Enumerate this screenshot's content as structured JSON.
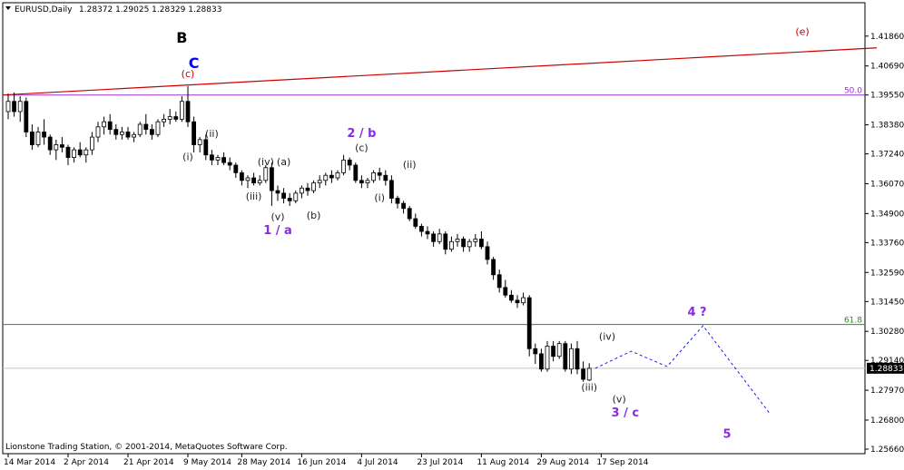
{
  "chart_data": {
    "type": "candlestick",
    "header": {
      "symbol": "EURUSD,Daily",
      "ohlc": "1.28372 1.29025 1.28329 1.28833"
    },
    "footer": "Lionstone Trading Station, © 2001-2014, MetaQuotes Software Corp.",
    "ylim": [
      1.2566,
      1.426
    ],
    "y_ticks": [
      "1.41860",
      "1.40690",
      "1.39550",
      "1.38380",
      "1.37240",
      "1.36070",
      "1.34900",
      "1.33760",
      "1.32590",
      "1.31450",
      "1.30280",
      "1.29140",
      "1.27970",
      "1.26800",
      "1.25660"
    ],
    "x_ticks": [
      "14 Mar 2014",
      "2 Apr 2014",
      "21 Apr 2014",
      "9 May 2014",
      "28 May 2014",
      "16 Jun 2014",
      "4 Jul 2014",
      "23 Jul 2014",
      "11 Aug 2014",
      "29 Aug 2014",
      "17 Sep 2014"
    ],
    "current_price": "1.28833",
    "levels": [
      {
        "label": "50.0",
        "value": 1.3955,
        "color": "#9932cc"
      },
      {
        "label": "61.8",
        "value": 1.3055,
        "color": "#2e8b2e"
      }
    ],
    "trendline": {
      "from": [
        0,
        1.3955
      ],
      "to": [
        145,
        1.414
      ],
      "color": "#cc0000"
    },
    "candles": [
      [
        1.389,
        1.396,
        1.386,
        1.393
      ],
      [
        1.393,
        1.3965,
        1.387,
        1.389
      ],
      [
        1.389,
        1.395,
        1.385,
        1.393
      ],
      [
        1.393,
        1.3945,
        1.379,
        1.381
      ],
      [
        1.381,
        1.384,
        1.374,
        1.376
      ],
      [
        1.376,
        1.383,
        1.375,
        1.381
      ],
      [
        1.381,
        1.386,
        1.376,
        1.379
      ],
      [
        1.379,
        1.38,
        1.372,
        1.374
      ],
      [
        1.374,
        1.378,
        1.37,
        1.376
      ],
      [
        1.376,
        1.379,
        1.373,
        1.375
      ],
      [
        1.375,
        1.376,
        1.368,
        1.371
      ],
      [
        1.371,
        1.375,
        1.369,
        1.374
      ],
      [
        1.374,
        1.377,
        1.371,
        1.372
      ],
      [
        1.372,
        1.375,
        1.369,
        1.374
      ],
      [
        1.374,
        1.381,
        1.372,
        1.379
      ],
      [
        1.379,
        1.385,
        1.377,
        1.383
      ],
      [
        1.383,
        1.387,
        1.38,
        1.385
      ],
      [
        1.385,
        1.388,
        1.38,
        1.382
      ],
      [
        1.382,
        1.384,
        1.378,
        1.38
      ],
      [
        1.38,
        1.383,
        1.378,
        1.381
      ],
      [
        1.381,
        1.383,
        1.378,
        1.379
      ],
      [
        1.379,
        1.381,
        1.377,
        1.38
      ],
      [
        1.38,
        1.385,
        1.379,
        1.384
      ],
      [
        1.384,
        1.388,
        1.38,
        1.382
      ],
      [
        1.382,
        1.384,
        1.378,
        1.38
      ],
      [
        1.38,
        1.386,
        1.379,
        1.385
      ],
      [
        1.385,
        1.388,
        1.383,
        1.386
      ],
      [
        1.386,
        1.39,
        1.384,
        1.387
      ],
      [
        1.387,
        1.389,
        1.385,
        1.386
      ],
      [
        1.386,
        1.395,
        1.385,
        1.393
      ],
      [
        1.393,
        1.399,
        1.383,
        1.385
      ],
      [
        1.385,
        1.387,
        1.373,
        1.376
      ],
      [
        1.376,
        1.379,
        1.373,
        1.378
      ],
      [
        1.378,
        1.38,
        1.37,
        1.372
      ],
      [
        1.372,
        1.374,
        1.368,
        1.37
      ],
      [
        1.37,
        1.372,
        1.368,
        1.371
      ],
      [
        1.371,
        1.373,
        1.368,
        1.369
      ],
      [
        1.369,
        1.371,
        1.366,
        1.368
      ],
      [
        1.368,
        1.369,
        1.363,
        1.365
      ],
      [
        1.365,
        1.366,
        1.36,
        1.362
      ],
      [
        1.362,
        1.364,
        1.359,
        1.363
      ],
      [
        1.363,
        1.365,
        1.36,
        1.361
      ],
      [
        1.361,
        1.364,
        1.36,
        1.362
      ],
      [
        1.362,
        1.368,
        1.361,
        1.367
      ],
      [
        1.367,
        1.369,
        1.352,
        1.358
      ],
      [
        1.358,
        1.36,
        1.354,
        1.357
      ],
      [
        1.357,
        1.359,
        1.353,
        1.355
      ],
      [
        1.355,
        1.357,
        1.352,
        1.354
      ],
      [
        1.354,
        1.358,
        1.353,
        1.357
      ],
      [
        1.357,
        1.36,
        1.355,
        1.359
      ],
      [
        1.359,
        1.361,
        1.356,
        1.358
      ],
      [
        1.358,
        1.362,
        1.357,
        1.361
      ],
      [
        1.361,
        1.364,
        1.359,
        1.362
      ],
      [
        1.362,
        1.365,
        1.36,
        1.364
      ],
      [
        1.364,
        1.366,
        1.361,
        1.363
      ],
      [
        1.363,
        1.366,
        1.362,
        1.365
      ],
      [
        1.365,
        1.372,
        1.364,
        1.37
      ],
      [
        1.37,
        1.371,
        1.366,
        1.368
      ],
      [
        1.368,
        1.369,
        1.361,
        1.362
      ],
      [
        1.362,
        1.364,
        1.359,
        1.361
      ],
      [
        1.361,
        1.363,
        1.359,
        1.362
      ],
      [
        1.362,
        1.366,
        1.361,
        1.365
      ],
      [
        1.365,
        1.367,
        1.362,
        1.364
      ],
      [
        1.364,
        1.366,
        1.36,
        1.362
      ],
      [
        1.362,
        1.364,
        1.353,
        1.355
      ],
      [
        1.355,
        1.356,
        1.351,
        1.353
      ],
      [
        1.353,
        1.354,
        1.349,
        1.351
      ],
      [
        1.351,
        1.352,
        1.346,
        1.347
      ],
      [
        1.347,
        1.349,
        1.343,
        1.344
      ],
      [
        1.344,
        1.345,
        1.34,
        1.342
      ],
      [
        1.342,
        1.344,
        1.339,
        1.341
      ],
      [
        1.341,
        1.342,
        1.336,
        1.338
      ],
      [
        1.338,
        1.343,
        1.337,
        1.341
      ],
      [
        1.341,
        1.342,
        1.333,
        1.335
      ],
      [
        1.335,
        1.34,
        1.334,
        1.338
      ],
      [
        1.338,
        1.341,
        1.336,
        1.339
      ],
      [
        1.339,
        1.34,
        1.334,
        1.336
      ],
      [
        1.336,
        1.339,
        1.334,
        1.338
      ],
      [
        1.338,
        1.341,
        1.336,
        1.339
      ],
      [
        1.339,
        1.342,
        1.335,
        1.336
      ],
      [
        1.336,
        1.338,
        1.329,
        1.331
      ],
      [
        1.331,
        1.332,
        1.323,
        1.325
      ],
      [
        1.325,
        1.327,
        1.318,
        1.32
      ],
      [
        1.32,
        1.323,
        1.316,
        1.317
      ],
      [
        1.317,
        1.319,
        1.314,
        1.315
      ],
      [
        1.315,
        1.317,
        1.312,
        1.314
      ],
      [
        1.314,
        1.318,
        1.313,
        1.316
      ],
      [
        1.316,
        1.317,
        1.293,
        1.296
      ],
      [
        1.296,
        1.298,
        1.29,
        1.294
      ],
      [
        1.294,
        1.296,
        1.287,
        1.288
      ],
      [
        1.288,
        1.299,
        1.287,
        1.297
      ],
      [
        1.297,
        1.299,
        1.291,
        1.293
      ],
      [
        1.293,
        1.299,
        1.292,
        1.298
      ],
      [
        1.298,
        1.299,
        1.287,
        1.288
      ],
      [
        1.288,
        1.298,
        1.286,
        1.296
      ],
      [
        1.296,
        1.299,
        1.286,
        1.288
      ],
      [
        1.288,
        1.291,
        1.283,
        1.284
      ],
      [
        1.2837,
        1.2903,
        1.2833,
        1.2883
      ]
    ],
    "projection": [
      [
        98,
        1.2883
      ],
      [
        104,
        1.295
      ],
      [
        110,
        1.289
      ],
      [
        116,
        1.305
      ],
      [
        127,
        1.271
      ]
    ],
    "wave_labels": [
      {
        "text": "B",
        "idx": 29,
        "price": 1.416,
        "color": "#000000",
        "size": "big"
      },
      {
        "text": "C",
        "idx": 31,
        "price": 1.406,
        "color": "#0000ff",
        "size": "big"
      },
      {
        "text": "(c)",
        "idx": 30,
        "price": 1.4025,
        "color": "#cc0000",
        "size": "small"
      },
      {
        "text": "(e)",
        "idx": 140,
        "price": 1.419,
        "color": "#cc0000",
        "size": "small"
      },
      {
        "text": "(i)",
        "idx": 30,
        "price": 1.37,
        "color": "#222222",
        "size": "small"
      },
      {
        "text": "(ii)",
        "idx": 34,
        "price": 1.379,
        "color": "#222222",
        "size": "small"
      },
      {
        "text": "(iii)",
        "idx": 41,
        "price": 1.3545,
        "color": "#222222",
        "size": "small"
      },
      {
        "text": "(iv)",
        "idx": 43,
        "price": 1.368,
        "color": "#222222",
        "size": "small"
      },
      {
        "text": "(a)",
        "idx": 46,
        "price": 1.368,
        "color": "#222222",
        "size": "small"
      },
      {
        "text": "(v)",
        "idx": 45,
        "price": 1.3465,
        "color": "#222222",
        "size": "small"
      },
      {
        "text": "(b)",
        "idx": 51,
        "price": 1.347,
        "color": "#222222",
        "size": "small"
      },
      {
        "text": "1 / a",
        "idx": 45,
        "price": 1.341,
        "color": "#8a2be2",
        "size": "major"
      },
      {
        "text": "2 / b",
        "idx": 59,
        "price": 1.379,
        "color": "#8a2be2",
        "size": "major"
      },
      {
        "text": "(c)",
        "idx": 59,
        "price": 1.3735,
        "color": "#222222",
        "size": "small"
      },
      {
        "text": "(i)",
        "idx": 62,
        "price": 1.354,
        "color": "#222222",
        "size": "small"
      },
      {
        "text": "(ii)",
        "idx": 67,
        "price": 1.367,
        "color": "#222222",
        "size": "small"
      },
      {
        "text": "(iv)",
        "idx": 100,
        "price": 1.2995,
        "color": "#222222",
        "size": "small"
      },
      {
        "text": "(iii)",
        "idx": 97,
        "price": 1.2795,
        "color": "#222222",
        "size": "small"
      },
      {
        "text": "(v)",
        "idx": 102,
        "price": 1.275,
        "color": "#222222",
        "size": "small"
      },
      {
        "text": "3 / c",
        "idx": 103,
        "price": 1.2695,
        "color": "#8a2be2",
        "size": "major"
      },
      {
        "text": "4 ?",
        "idx": 115,
        "price": 1.309,
        "color": "#8a2be2",
        "size": "major"
      },
      {
        "text": "5",
        "idx": 120,
        "price": 1.261,
        "color": "#8a2be2",
        "size": "major"
      }
    ]
  }
}
